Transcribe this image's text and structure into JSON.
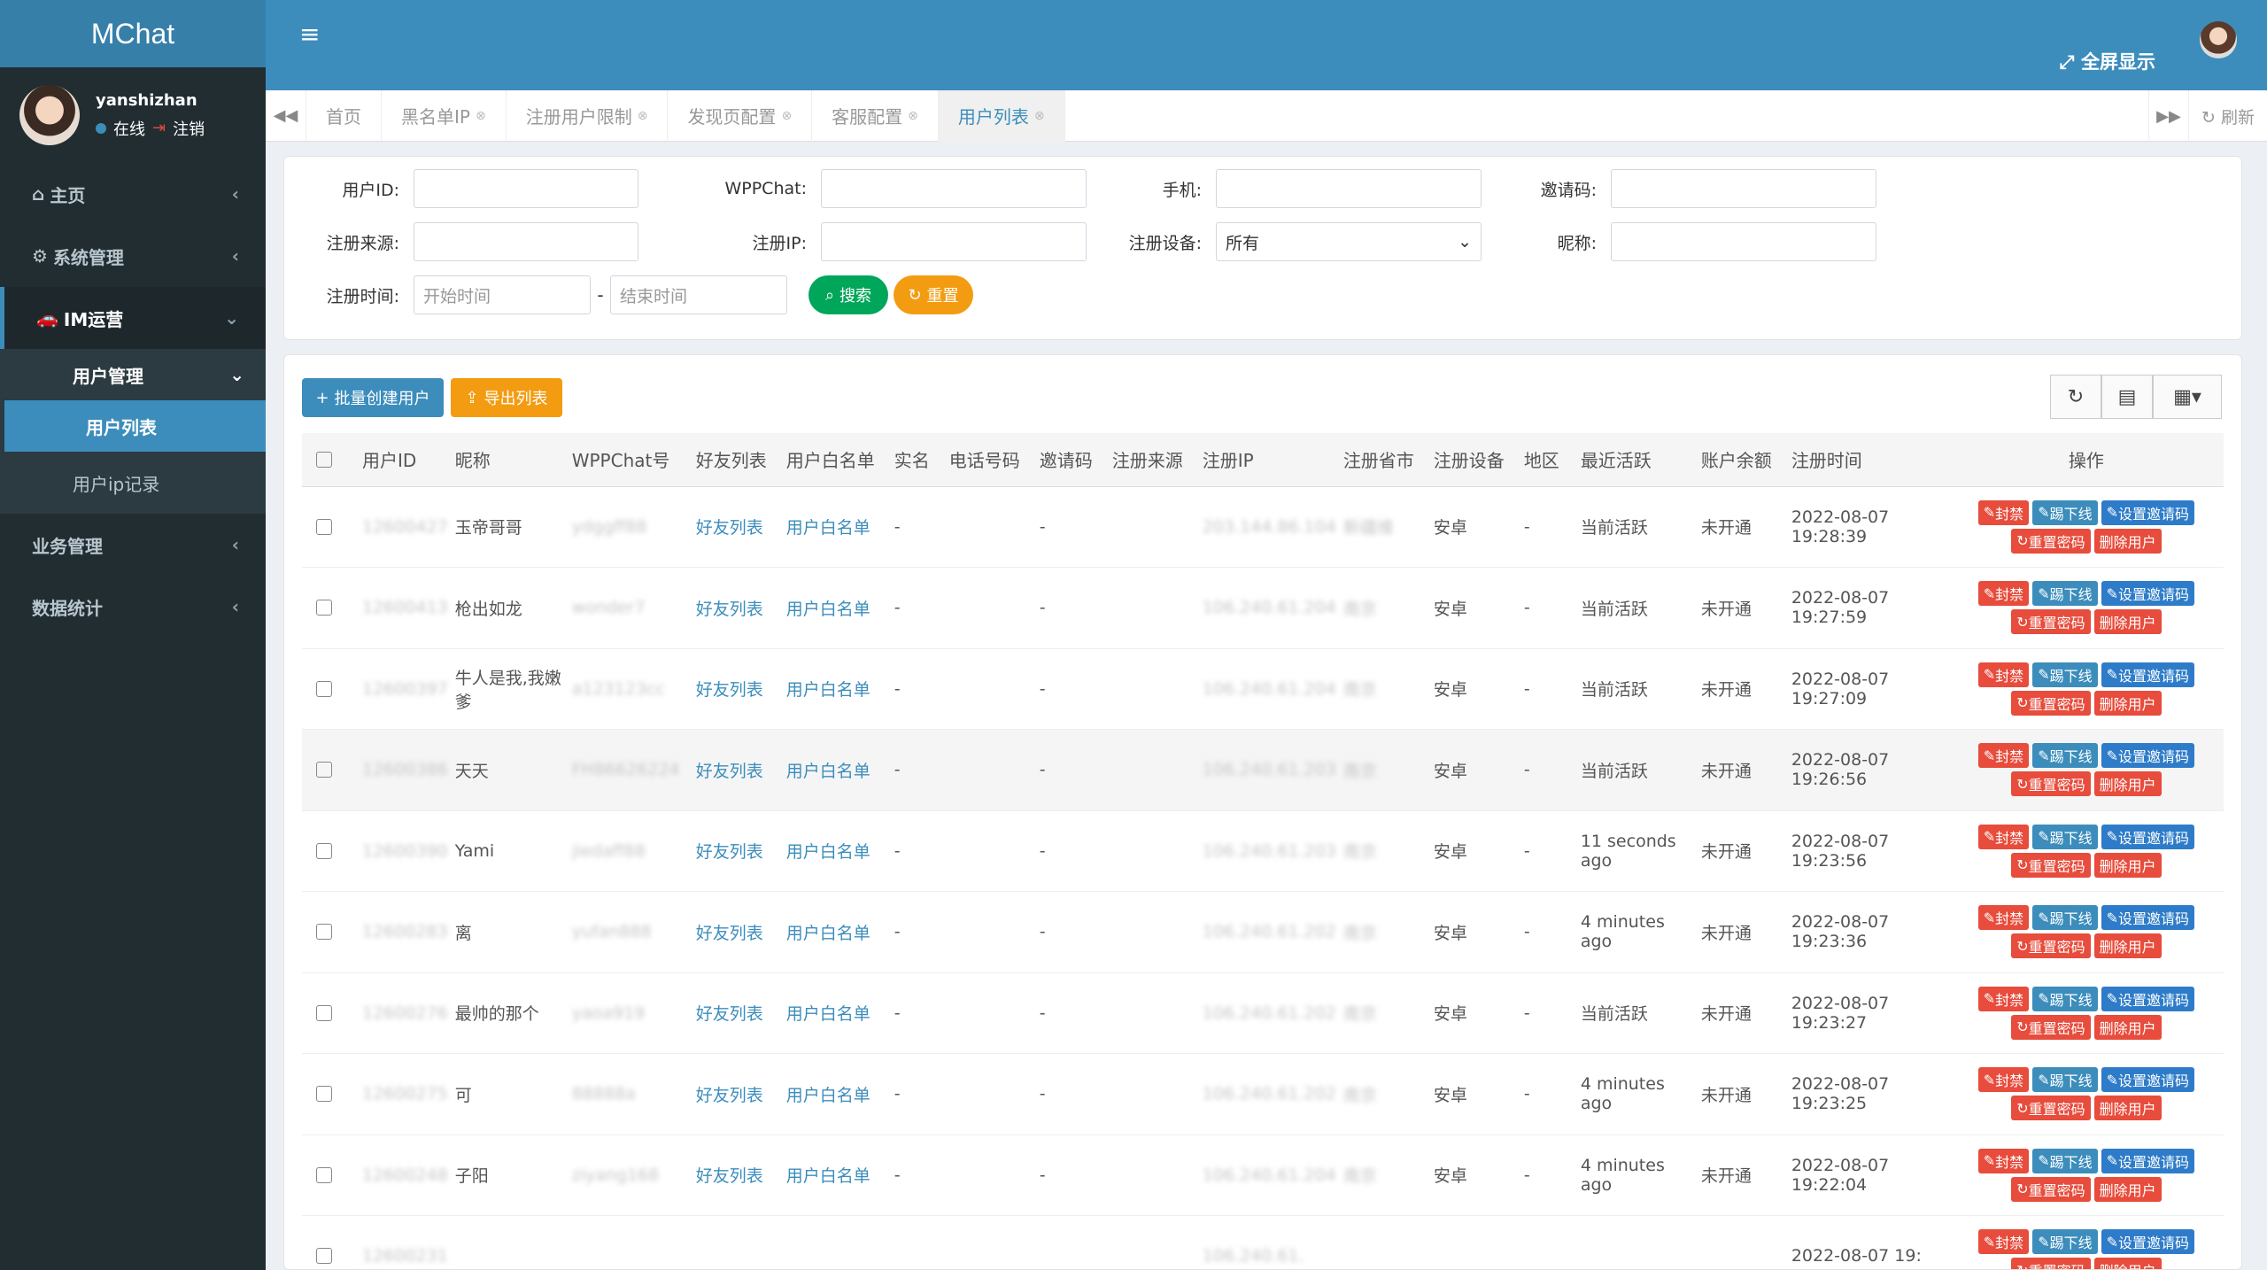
{
  "app": {
    "logo": "MChat"
  },
  "user": {
    "name": "yanshizhan",
    "status": "在线",
    "logout": "注销"
  },
  "sidebar": {
    "items": [
      {
        "label": "主页"
      },
      {
        "label": "系统管理"
      },
      {
        "label": "IM运营"
      }
    ],
    "submenu": {
      "group": "用户管理",
      "items": [
        "用户列表",
        "用户ip记录"
      ]
    },
    "bottom": [
      "业务管理",
      "数据统计"
    ]
  },
  "topbar": {
    "fullscreen": "全屏显示"
  },
  "tabs": {
    "items": [
      {
        "label": "首页"
      },
      {
        "label": "黑名单IP"
      },
      {
        "label": "注册用户限制"
      },
      {
        "label": "发现页配置"
      },
      {
        "label": "客服配置"
      },
      {
        "label": "用户列表"
      }
    ],
    "refresh": "刷新"
  },
  "filter": {
    "uid_label": "用户ID:",
    "wpp_label": "WPPChat:",
    "phone_label": "手机:",
    "invite_label": "邀请码:",
    "source_label": "注册来源:",
    "ip_label": "注册IP:",
    "device_label": "注册设备:",
    "device_value": "所有",
    "nick_label": "昵称:",
    "time_label": "注册时间:",
    "start_placeholder": "开始时间",
    "dash": "-",
    "end_placeholder": "结束时间",
    "search": "搜索",
    "reset": "重置"
  },
  "toolbar": {
    "batch_create": "批量创建用户",
    "export": "导出列表"
  },
  "table": {
    "headers": [
      "用户ID",
      "昵称",
      "WPPChat号",
      "好友列表",
      "用户白名单",
      "实名",
      "电话号码",
      "邀请码",
      "注册来源",
      "注册IP",
      "注册省市",
      "注册设备",
      "地区",
      "最近活跃",
      "账户余额",
      "注册时间",
      "操作"
    ],
    "rows": [
      {
        "id": "12600427",
        "nick": "玉帝哥哥",
        "wpp": "ydggff88",
        "friends": "好友列表",
        "whitelist": "用户白名单",
        "realname": "-",
        "invite": "-",
        "ip": "203.144.86.104",
        "province": "新疆维",
        "device": "安卓",
        "region": "-",
        "active": "当前活跃",
        "balance": "未开通",
        "time": "2022-08-07 19:28:39"
      },
      {
        "id": "12600413",
        "nick": "枪出如龙",
        "wpp": "wonder7",
        "friends": "好友列表",
        "whitelist": "用户白名单",
        "realname": "-",
        "invite": "-",
        "ip": "106.240.61.204",
        "province": "南京",
        "device": "安卓",
        "region": "-",
        "active": "当前活跃",
        "balance": "未开通",
        "time": "2022-08-07 19:27:59"
      },
      {
        "id": "12600397",
        "nick": "牛人是我,我嫩爹",
        "wpp": "a123123cc",
        "friends": "好友列表",
        "whitelist": "用户白名单",
        "realname": "-",
        "invite": "-",
        "ip": "106.240.61.204",
        "province": "南京",
        "device": "安卓",
        "region": "-",
        "active": "当前活跃",
        "balance": "未开通",
        "time": "2022-08-07 19:27:09"
      },
      {
        "id": "12600386",
        "nick": "天天",
        "wpp": "FH86626224",
        "friends": "好友列表",
        "whitelist": "用户白名单",
        "realname": "-",
        "invite": "-",
        "ip": "106.240.61.203",
        "province": "南京",
        "device": "安卓",
        "region": "-",
        "active": "当前活跃",
        "balance": "未开通",
        "time": "2022-08-07 19:26:56"
      },
      {
        "id": "12600390",
        "nick": "Yami",
        "wpp": "jiedaff88",
        "friends": "好友列表",
        "whitelist": "用户白名单",
        "realname": "-",
        "invite": "-",
        "ip": "106.240.61.203",
        "province": "南京",
        "device": "安卓",
        "region": "-",
        "active": "11 seconds ago",
        "balance": "未开通",
        "time": "2022-08-07 19:23:56"
      },
      {
        "id": "12600283",
        "nick": "离",
        "wpp": "yufan888",
        "friends": "好友列表",
        "whitelist": "用户白名单",
        "realname": "-",
        "invite": "-",
        "ip": "106.240.61.202",
        "province": "南京",
        "device": "安卓",
        "region": "-",
        "active": "4 minutes ago",
        "balance": "未开通",
        "time": "2022-08-07 19:23:36"
      },
      {
        "id": "12600276",
        "nick": "最帅的那个",
        "wpp": "yaoa919",
        "friends": "好友列表",
        "whitelist": "用户白名单",
        "realname": "-",
        "invite": "-",
        "ip": "106.240.61.202",
        "province": "南京",
        "device": "安卓",
        "region": "-",
        "active": "当前活跃",
        "balance": "未开通",
        "time": "2022-08-07 19:23:27"
      },
      {
        "id": "12600275",
        "nick": "可",
        "wpp": "88888a",
        "friends": "好友列表",
        "whitelist": "用户白名单",
        "realname": "-",
        "invite": "-",
        "ip": "106.240.61.202",
        "province": "南京",
        "device": "安卓",
        "region": "-",
        "active": "4 minutes ago",
        "balance": "未开通",
        "time": "2022-08-07 19:23:25"
      },
      {
        "id": "12600248",
        "nick": "子阳",
        "wpp": "ziyang168",
        "friends": "好友列表",
        "whitelist": "用户白名单",
        "realname": "-",
        "invite": "-",
        "ip": "106.240.61.204",
        "province": "南京",
        "device": "安卓",
        "region": "-",
        "active": "4 minutes ago",
        "balance": "未开通",
        "time": "2022-08-07 19:22:04"
      },
      {
        "id": "12600231",
        "nick": "",
        "wpp": "",
        "friends": "",
        "whitelist": "",
        "realname": "",
        "invite": "",
        "ip": "106.240.61.",
        "province": "",
        "device": "",
        "region": "",
        "active": "",
        "balance": "",
        "time": "2022-08-07 19:"
      }
    ],
    "ops": {
      "ban": "封禁",
      "kick": "踢下线",
      "set_invite": "设置邀请码",
      "reset_pwd": "重置密码",
      "delete": "删除用户"
    }
  },
  "colors": {
    "brand": "#3c8dbc",
    "sidebar": "#222d32",
    "search": "#00a65a",
    "reset": "#f39c12",
    "danger": "#e74c3c"
  }
}
